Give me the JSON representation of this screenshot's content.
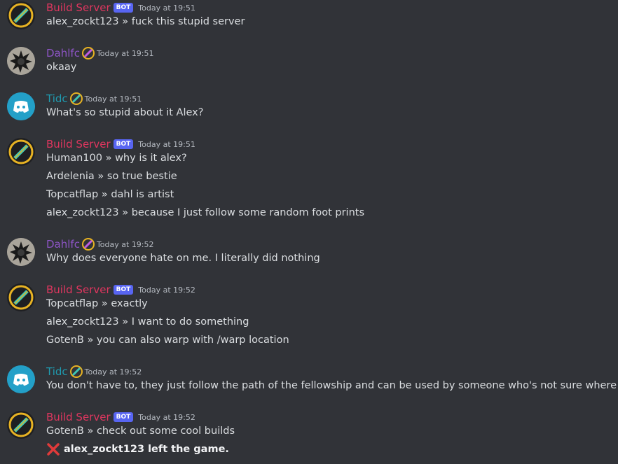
{
  "colors": {
    "background": "#313338",
    "bot_name": "#e0365f",
    "dahl_name": "#8e55c7",
    "tidc_name": "#1f9bb0",
    "bot_badge": "#5865f2",
    "leave_icon": "#e03a3a"
  },
  "messages": [
    {
      "author": "Build Server",
      "bot_badge": "BOT",
      "timestamp": "Today at 19:51",
      "lines": [
        {
          "user": "alex_zockt123",
          "sep": " » ",
          "text": "fuck this stupid server"
        }
      ]
    },
    {
      "author": "Dahlfc",
      "timestamp": "Today at 19:51",
      "lines": [
        {
          "text": "okaay"
        }
      ]
    },
    {
      "author": "Tidc",
      "timestamp": "Today at 19:51",
      "lines": [
        {
          "text": "What's so stupid about it Alex?"
        }
      ]
    },
    {
      "author": "Build Server",
      "bot_badge": "BOT",
      "timestamp": "Today at 19:51",
      "lines": [
        {
          "user": "Human100",
          "sep": " » ",
          "text": "why is it alex?"
        },
        {
          "user": "Ardelenia",
          "sep": " » ",
          "text": "so true bestie"
        },
        {
          "user": "Topcatflap",
          "sep": " » ",
          "text": "dahl is artist"
        },
        {
          "user": "alex_zockt123",
          "sep": " » ",
          "text": "because I just follow some random foot prints"
        }
      ]
    },
    {
      "author": "Dahlfc",
      "timestamp": "Today at 19:52",
      "lines": [
        {
          "text": "Why does everyone hate on me. I literally did nothing"
        }
      ]
    },
    {
      "author": "Build Server",
      "bot_badge": "BOT",
      "timestamp": "Today at 19:52",
      "lines": [
        {
          "user": "Topcatflap",
          "sep": " » ",
          "text": "exactly"
        },
        {
          "user": "alex_zockt123",
          "sep": " » ",
          "text": "I want to do something"
        },
        {
          "user": "GotenB",
          "sep": " » ",
          "text": "you can also warp with /warp location"
        }
      ]
    },
    {
      "author": "Tidc",
      "timestamp": "Today at 19:52",
      "lines": [
        {
          "text": "You don't have to, they just follow the path of the fellowship and can be used by someone who's not sure where to go"
        }
      ]
    },
    {
      "author": "Build Server",
      "bot_badge": "BOT",
      "timestamp": "Today at 19:52",
      "lines": [
        {
          "user": "GotenB",
          "sep": " » ",
          "text": "check out some cool builds"
        },
        {
          "text": "alex_zockt123 left the game.",
          "icon": "red-x-icon"
        }
      ]
    }
  ]
}
